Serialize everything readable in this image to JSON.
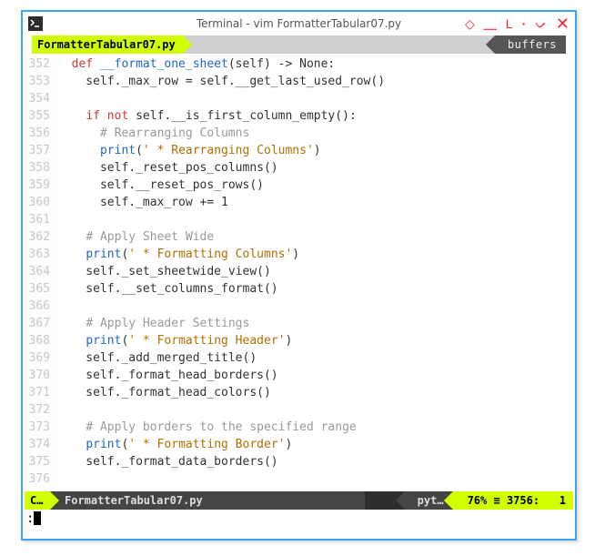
{
  "window": {
    "title": "Terminal - vim FormatterTabular07.py"
  },
  "tabline": {
    "active_tab": "FormatterTabular07.py",
    "buffers_label": "buffers"
  },
  "code": {
    "lines": [
      {
        "n": "352",
        "t": "  ",
        "k": "def ",
        "f": "__format_one_sheet",
        "r": "(self) -> None:"
      },
      {
        "n": "353",
        "t": "    self._max_row = self.__get_last_used_row()"
      },
      {
        "n": "354",
        "t": ""
      },
      {
        "n": "355",
        "t": "    ",
        "k": "if not ",
        "r": "self.__is_first_column_empty():"
      },
      {
        "n": "356",
        "t": "      ",
        "c": "# Rearranging Columns"
      },
      {
        "n": "357",
        "t": "      ",
        "f2": "print",
        "r": "(",
        "s": "' * Rearranging Columns'",
        "r2": ")"
      },
      {
        "n": "358",
        "t": "      self._reset_pos_columns()"
      },
      {
        "n": "359",
        "t": "      self.__reset_pos_rows()"
      },
      {
        "n": "360",
        "t": "      self._max_row += ",
        "num": "1"
      },
      {
        "n": "361",
        "t": ""
      },
      {
        "n": "362",
        "t": "    ",
        "c": "# Apply Sheet Wide"
      },
      {
        "n": "363",
        "t": "    ",
        "f2": "print",
        "r": "(",
        "s": "' * Formatting Columns'",
        "r2": ")"
      },
      {
        "n": "364",
        "t": "    self._set_sheetwide_view()"
      },
      {
        "n": "365",
        "t": "    self.__set_columns_format()"
      },
      {
        "n": "366",
        "t": ""
      },
      {
        "n": "367",
        "t": "    ",
        "c": "# Apply Header Settings"
      },
      {
        "n": "368",
        "t": "    ",
        "f2": "print",
        "r": "(",
        "s": "' * Formatting Header'",
        "r2": ")"
      },
      {
        "n": "369",
        "t": "    self._add_merged_title()"
      },
      {
        "n": "370",
        "t": "    self._format_head_borders()"
      },
      {
        "n": "371",
        "t": "    self._format_head_colors()"
      },
      {
        "n": "372",
        "t": ""
      },
      {
        "n": "373",
        "t": "    ",
        "c": "# Apply borders to the specified range"
      },
      {
        "n": "374",
        "t": "    ",
        "f2": "print",
        "r": "(",
        "s": "' * Formatting Border'",
        "r2": ")"
      },
      {
        "n": "375",
        "t": "    self._format_data_borders()"
      },
      {
        "n": "376",
        "t": ""
      }
    ]
  },
  "status": {
    "mode": "C…",
    "file": "FormatterTabular07.py",
    "filetype": "pyt…",
    "percent": "76%",
    "sep": "≡",
    "line": "3756",
    "col": "1"
  },
  "cmdline": {
    "prompt": ":"
  }
}
